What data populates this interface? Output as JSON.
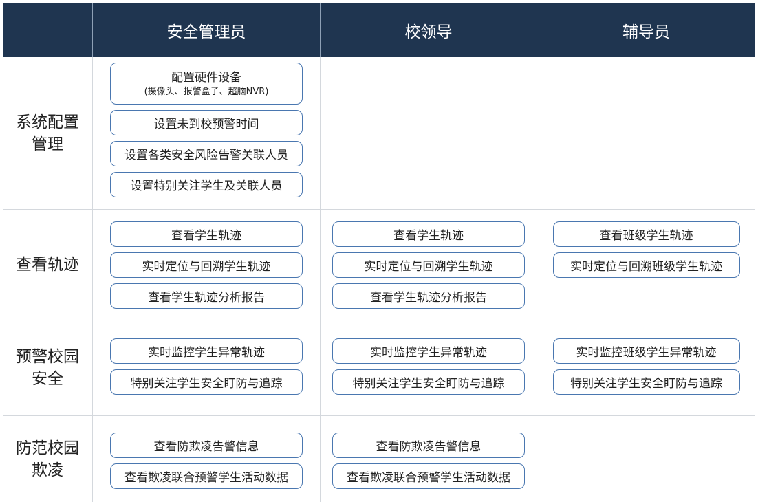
{
  "header": {
    "corner": "",
    "col1": "安全管理员",
    "col2": "校领导",
    "col3": "辅导员"
  },
  "rows": {
    "config": {
      "label": "系统配置管理",
      "admin": [
        {
          "title": "配置硬件设备",
          "sub": "(摄像头、报警盒子、超脑NVR)"
        },
        {
          "title": "设置未到校预警时间"
        },
        {
          "title": "设置各类安全风险告警关联人员"
        },
        {
          "title": "设置特别关注学生及关联人员"
        }
      ]
    },
    "track": {
      "label": "查看轨迹",
      "admin": [
        "查看学生轨迹",
        "实时定位与回溯学生轨迹",
        "查看学生轨迹分析报告"
      ],
      "leader": [
        "查看学生轨迹",
        "实时定位与回溯学生轨迹",
        "查看学生轨迹分析报告"
      ],
      "counselor": [
        "查看班级学生轨迹",
        "实时定位与回溯班级学生轨迹"
      ]
    },
    "alert": {
      "label": "预警校园安全",
      "admin": [
        "实时监控学生异常轨迹",
        "特别关注学生安全盯防与追踪"
      ],
      "leader": [
        "实时监控学生异常轨迹",
        "特别关注学生安全盯防与追踪"
      ],
      "counselor": [
        "实时监控班级学生异常轨迹",
        "特别关注学生安全盯防与追踪"
      ]
    },
    "bully": {
      "label": "防范校园欺凌",
      "admin": [
        "查看防欺凌告警信息",
        "查看欺凌联合预警学生活动数据"
      ],
      "leader": [
        "查看防欺凌告警信息",
        "查看欺凌联合预警学生活动数据"
      ]
    }
  },
  "colors": {
    "header_bg": "#1f3550",
    "pill_border": "#4a77b0",
    "grid_line": "#d4d8dd"
  }
}
